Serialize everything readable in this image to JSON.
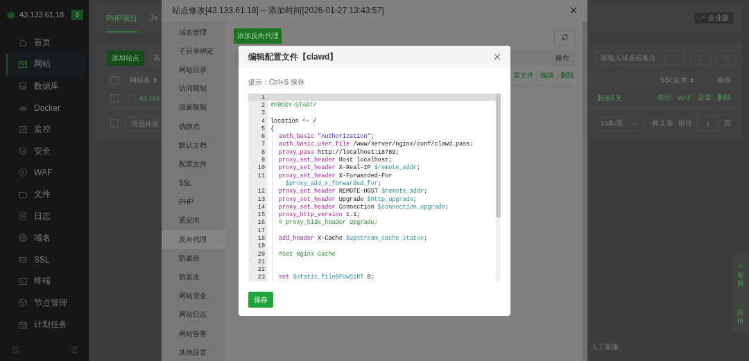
{
  "sidebar": {
    "host": "43.133.61.18",
    "badge": "0",
    "items": [
      {
        "label": "首页",
        "selected": false
      },
      {
        "label": "网站",
        "selected": true
      },
      {
        "label": "数据库",
        "selected": false
      },
      {
        "label": "Docker",
        "selected": false
      },
      {
        "label": "监控",
        "selected": false
      },
      {
        "label": "安全",
        "selected": false
      },
      {
        "label": "WAF",
        "selected": false
      },
      {
        "label": "文件",
        "selected": false
      },
      {
        "label": "日志",
        "selected": false
      },
      {
        "label": "域名",
        "selected": false
      },
      {
        "label": "SSL",
        "selected": false
      },
      {
        "label": "终端",
        "selected": false
      },
      {
        "label": "节点管理",
        "selected": false
      },
      {
        "label": "计划任务",
        "selected": false
      }
    ]
  },
  "project_tabs": [
    {
      "label": "PHP项目",
      "selected": true
    },
    {
      "label": "Ja",
      "selected": false
    }
  ],
  "edition_button": "企业版",
  "toolbar": {
    "add_site": "添加站点",
    "button_2": "高",
    "search_placeholder": "请输入域名或备注"
  },
  "site_table": {
    "select_all_checked": false,
    "columns": [
      {
        "label": "网站名",
        "sortable": true
      },
      {
        "label": "SSL证书",
        "sortable": true
      },
      {
        "label": "操作",
        "sortable": false
      }
    ],
    "rows": [
      {
        "checked": false,
        "name": "43.133.",
        "ssl": "剩余6天",
        "actions": [
          "统计",
          "WAF",
          "设置",
          "删除"
        ]
      }
    ]
  },
  "batch": {
    "checked": false,
    "placeholder": "请选择批"
  },
  "pagination": {
    "page_size": "10条/页",
    "total": "共 1 条",
    "goto": "前往",
    "page": "1",
    "page_unit": "页"
  },
  "float_buttons": [
    "客服",
    "评价"
  ],
  "service_link": "人工客服",
  "site_dialog": {
    "title": "站点修改[43.133.61.18] -- 添加时间[2026-01-27 13:43:57]",
    "menu": [
      {
        "label": "域名管理",
        "selected": false
      },
      {
        "label": "子目录绑定",
        "selected": false
      },
      {
        "label": "网站目录",
        "selected": false
      },
      {
        "label": "访问限制",
        "selected": false
      },
      {
        "label": "流量限制",
        "selected": false
      },
      {
        "label": "伪静态",
        "selected": false
      },
      {
        "label": "默认文档",
        "selected": false
      },
      {
        "label": "配置文件",
        "selected": false
      },
      {
        "label": "SSL",
        "selected": false
      },
      {
        "label": "PHP",
        "selected": false
      },
      {
        "label": "重定向",
        "selected": false
      },
      {
        "label": "反向代理",
        "selected": true
      },
      {
        "label": "防盗链",
        "selected": false
      },
      {
        "label": "防篡改",
        "selected": false
      },
      {
        "label": "网站安全",
        "selected": false
      },
      {
        "label": "网站日志",
        "selected": false
      },
      {
        "label": "网站告警",
        "selected": false
      },
      {
        "label": "其他设置",
        "selected": false
      }
    ],
    "add_button": "添加反向代理",
    "table_header": "操作",
    "row_actions": [
      "置文件",
      "编辑",
      "删除"
    ]
  },
  "editor_dialog": {
    "title": "编辑配置文件【clawd】",
    "hint": "提示：Ctrl+S 保存",
    "save": "保存",
    "lines": [
      {
        "n": "1",
        "current": true,
        "indented": false
      },
      {
        "n": "2",
        "current": false,
        "indented": false,
        "tokens": [
          {
            "kind": "comment",
            "t": "#PROXY-START/"
          }
        ]
      },
      {
        "n": "3",
        "current": false,
        "indented": false
      },
      {
        "n": "4",
        "current": false,
        "indented": false,
        "tokens": [
          {
            "kind": "plain",
            "t": "location "
          },
          {
            "kind": "op",
            "t": "^~"
          },
          {
            "kind": "plain",
            "t": " /"
          }
        ]
      },
      {
        "n": "5",
        "current": false,
        "indented": false,
        "tokens": [
          {
            "kind": "plain",
            "t": "{"
          }
        ]
      },
      {
        "n": "6",
        "current": false,
        "indented": true,
        "tokens": [
          {
            "kind": "kw",
            "t": "auth_basic"
          },
          {
            "kind": "str",
            "t": " \"Authorization\""
          },
          {
            "kind": "plain",
            "t": ";"
          }
        ]
      },
      {
        "n": "7",
        "current": false,
        "indented": true,
        "tokens": [
          {
            "kind": "kw",
            "t": "auth_basic_user_file"
          },
          {
            "kind": "plain",
            "t": " /www/server/nginx/conf/clawd.pass;"
          }
        ]
      },
      {
        "n": "8",
        "current": false,
        "indented": true,
        "tokens": [
          {
            "kind": "kw",
            "t": "proxy_pass"
          },
          {
            "kind": "plain",
            "t": " http://localhost:18789;"
          }
        ]
      },
      {
        "n": "9",
        "current": false,
        "indented": true,
        "tokens": [
          {
            "kind": "kw",
            "t": "proxy_set_header"
          },
          {
            "kind": "plain",
            "t": " Host localhost;"
          }
        ]
      },
      {
        "n": "10",
        "current": false,
        "indented": true,
        "tokens": [
          {
            "kind": "kw",
            "t": "proxy_set_header"
          },
          {
            "kind": "plain",
            "t": " X-Real-IP "
          },
          {
            "kind": "var",
            "t": "$remote_addr"
          },
          {
            "kind": "plain",
            "t": ";"
          }
        ]
      },
      {
        "n": "11",
        "current": false,
        "indented": true,
        "tokens": [
          {
            "kind": "kw",
            "t": "proxy_set_header"
          },
          {
            "kind": "plain",
            "t": " X-Forwarded-For"
          }
        ],
        "wrap": [
          {
            "kind": "var",
            "t": "$proxy_add_x_forwarded_for"
          },
          {
            "kind": "plain",
            "t": ";"
          }
        ]
      },
      {
        "n": "12",
        "current": false,
        "indented": true,
        "tokens": [
          {
            "kind": "kw",
            "t": "proxy_set_header"
          },
          {
            "kind": "plain",
            "t": " REMOTE-HOST "
          },
          {
            "kind": "var",
            "t": "$remote_addr"
          },
          {
            "kind": "plain",
            "t": ";"
          }
        ]
      },
      {
        "n": "13",
        "current": false,
        "indented": true,
        "tokens": [
          {
            "kind": "kw",
            "t": "proxy_set_header"
          },
          {
            "kind": "plain",
            "t": " Upgrade "
          },
          {
            "kind": "var",
            "t": "$http_upgrade"
          },
          {
            "kind": "plain",
            "t": ";"
          }
        ]
      },
      {
        "n": "14",
        "current": false,
        "indented": true,
        "tokens": [
          {
            "kind": "kw",
            "t": "proxy_set_header"
          },
          {
            "kind": "plain",
            "t": " Connection "
          },
          {
            "kind": "var",
            "t": "$connection_upgrade"
          },
          {
            "kind": "plain",
            "t": ";"
          }
        ]
      },
      {
        "n": "15",
        "current": false,
        "indented": true,
        "tokens": [
          {
            "kind": "kw",
            "t": "proxy_http_version"
          },
          {
            "kind": "plain",
            "t": " 1.1;"
          }
        ]
      },
      {
        "n": "16",
        "current": false,
        "indented": true,
        "tokens": [
          {
            "kind": "comment",
            "t": "# proxy_hide_header Upgrade;"
          }
        ]
      },
      {
        "n": "17",
        "current": false,
        "indented": true
      },
      {
        "n": "18",
        "current": false,
        "indented": true,
        "tokens": [
          {
            "kind": "kw",
            "t": "add_header"
          },
          {
            "kind": "plain",
            "t": " X-Cache "
          },
          {
            "kind": "var",
            "t": "$upstream_cache_status"
          },
          {
            "kind": "plain",
            "t": ";"
          }
        ]
      },
      {
        "n": "19",
        "current": false,
        "indented": true
      },
      {
        "n": "20",
        "current": false,
        "indented": true,
        "tokens": [
          {
            "kind": "comment",
            "t": "#Set Nginx Cache"
          }
        ]
      },
      {
        "n": "21",
        "current": false,
        "indented": true
      },
      {
        "n": "22",
        "current": false,
        "indented": true
      },
      {
        "n": "23",
        "current": false,
        "indented": true,
        "tokens": [
          {
            "kind": "kw",
            "t": "set"
          },
          {
            "kind": "var",
            "t": " $static_fileBFUw5iRT"
          },
          {
            "kind": "plain",
            "t": " 0;"
          }
        ]
      }
    ]
  }
}
